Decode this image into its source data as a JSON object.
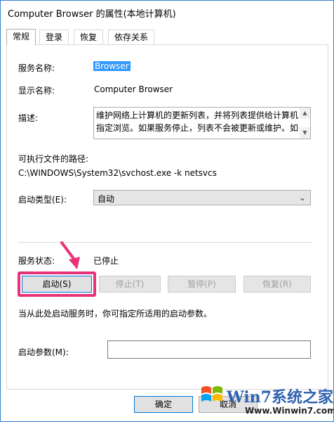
{
  "window": {
    "title": "Computer Browser 的属性(本地计算机)"
  },
  "tabs": [
    {
      "label": "常规"
    },
    {
      "label": "登录"
    },
    {
      "label": "恢复"
    },
    {
      "label": "依存关系"
    }
  ],
  "general": {
    "service_name_label": "服务名称:",
    "service_name_value": "Browser",
    "display_name_label": "显示名称:",
    "display_name_value": "Computer Browser",
    "description_label": "描述:",
    "description_value": "维护网络上计算机的更新列表，并将列表提供给计算机指定浏览。如果服务停止，列表不会被更新或维护。如",
    "exe_path_label": "可执行文件的路径:",
    "exe_path_value": "C:\\WINDOWS\\System32\\svchost.exe -k netsvcs",
    "startup_type_label": "启动类型(E):",
    "startup_type_value": "自动",
    "service_status_label": "服务状态:",
    "service_status_value": "已停止",
    "buttons": {
      "start": "启动(S)",
      "stop": "停止(T)",
      "pause": "暂停(P)",
      "resume": "恢复(R)"
    },
    "hint_text": "当从此处启动服务时，你可指定所适用的启动参数。",
    "start_params_label": "启动参数(M):",
    "start_params_value": ""
  },
  "footer": {
    "ok": "确定",
    "cancel": "取消"
  },
  "watermark": {
    "logo_text": "Win7系统之家",
    "url": "Www.Winwin7.com"
  },
  "colors": {
    "highlight": "#e8327a",
    "selection": "#3399ff",
    "frame": "#3b7fd4"
  }
}
